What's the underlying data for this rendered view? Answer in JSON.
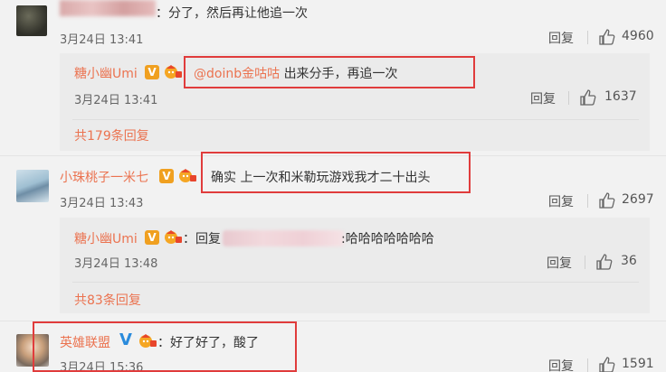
{
  "comment1": {
    "text_prefix_redacted": "",
    "text": "：分了，然后再让他追一次",
    "time": "3月24日 13:41",
    "reply_label": "回复",
    "likes": "4960",
    "sub": {
      "username": "糖小幽Umi",
      "mention": "@doinb金咕咕",
      "text": "出来分手，再追一次",
      "time": "3月24日 13:41",
      "reply_label": "回复",
      "likes": "1637",
      "more": "共179条回复"
    }
  },
  "comment2": {
    "username": "小珠桃子一米七",
    "text": "确实 上一次和米勒玩游戏我才二十出头",
    "time": "3月24日 13:43",
    "reply_label": "回复",
    "likes": "2697",
    "sub": {
      "username": "糖小幽Umi",
      "reply_prefix": "：回复",
      "text": ":哈哈哈哈哈哈哈",
      "time": "3月24日 13:48",
      "reply_label": "回复",
      "likes": "36",
      "more": "共83条回复"
    }
  },
  "comment3": {
    "username": "英雄联盟",
    "text": "：好了好了，酸了",
    "time": "3月24日 15:36",
    "reply_label": "回复",
    "likes": "1591"
  },
  "colors": {
    "accent": "#eb7350",
    "highlight_box": "#e03c3c",
    "verified_orange": "#f0a020",
    "verified_blue": "#2a8bdc"
  },
  "icons": {
    "like": "thumbs-up-icon",
    "verified_orange": "verified-v-orange-icon",
    "verified_blue": "verified-v-blue-icon",
    "vip": "vip-badge-icon"
  }
}
